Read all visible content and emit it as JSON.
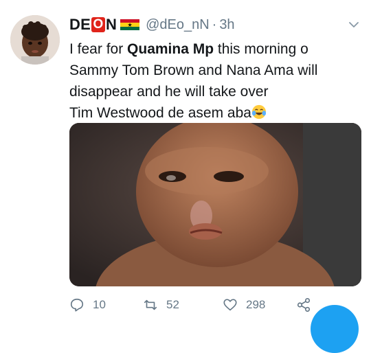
{
  "tweet": {
    "display_name_prefix": "DE",
    "display_name_badge": "O",
    "display_name_suffix": "N",
    "handle": "@dEo_nN",
    "separator": "·",
    "time": "3h",
    "text_line1_pre": "I fear for ",
    "text_line1_bold": "Quamina Mp",
    "text_line1_post": " this morning o",
    "text_line2": "Sammy Tom Brown and Nana Ama will",
    "text_line3": "disappear and he will take over",
    "text_line4": "Tim Westwood de asem aba",
    "emoji": "face-with-tears-of-joy"
  },
  "actions": {
    "reply_count": "10",
    "retweet_count": "52",
    "like_count": "298"
  },
  "colors": {
    "brand": "#1da1f2",
    "muted": "#657786",
    "badge_red": "#e0241b"
  }
}
